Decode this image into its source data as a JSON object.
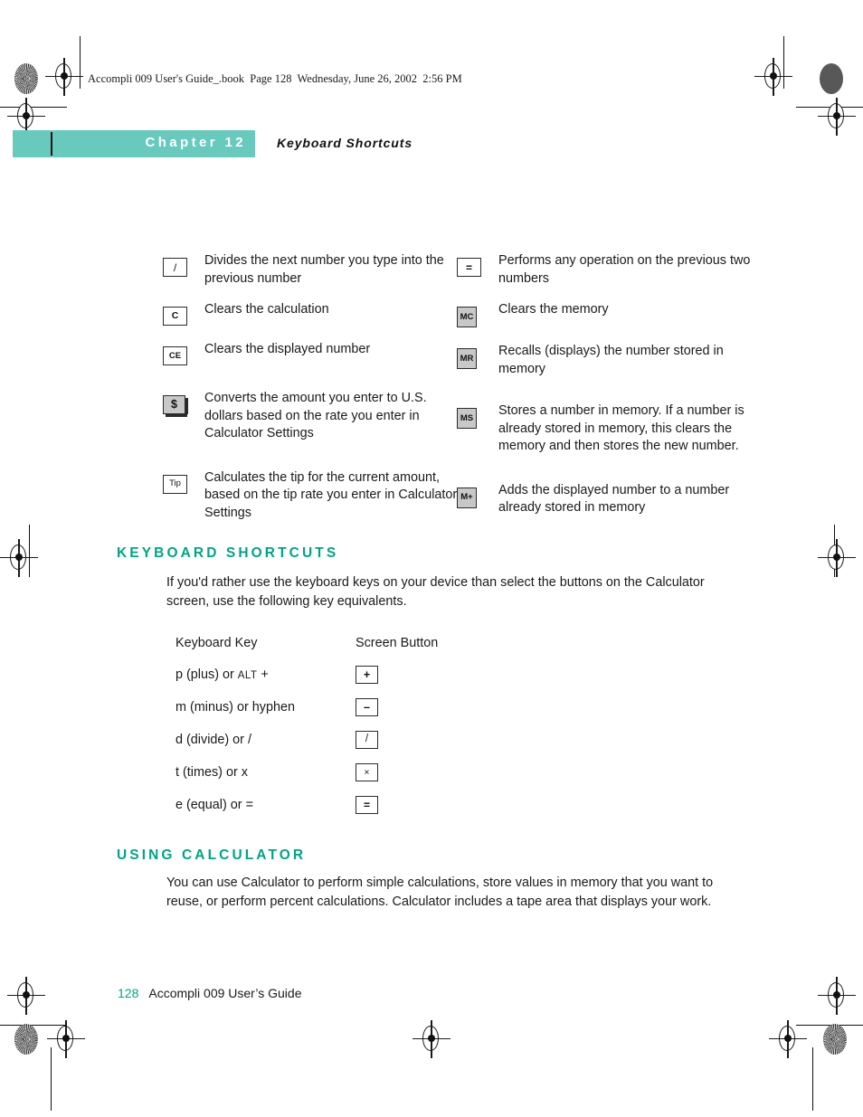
{
  "book_header": "Accompli 009 User's Guide_.book  Page 128  Wednesday, June 26, 2002  2:56 PM",
  "chapter": {
    "label": "Chapter 12",
    "title": "Keyboard Shortcuts"
  },
  "button_definitions": {
    "left_column": [
      {
        "icon": "divide-button-icon",
        "glyph": "/",
        "style": "white",
        "size": "wide",
        "description": "Divides the next number you type into the previous number"
      },
      {
        "icon": "clear-button-icon",
        "glyph": "C",
        "style": "white",
        "size": "wide",
        "description": "Clears the calculation"
      },
      {
        "icon": "clear-entry-button-icon",
        "glyph": "CE",
        "style": "white",
        "size": "wide",
        "description": "Clears the displayed number"
      },
      {
        "icon": "dollar-button-icon",
        "glyph": "$",
        "style": "gray",
        "size": "wide",
        "description": "Converts the amount you enter to U.S. dollars based on the rate you enter in Calculator Settings"
      },
      {
        "icon": "tip-button-icon",
        "glyph": "Tip",
        "style": "white",
        "size": "wide",
        "description": "Calculates the tip for the current amount, based on the tip rate you enter in Calculator Settings"
      }
    ],
    "right_column": [
      {
        "icon": "equals-button-icon",
        "glyph": "=",
        "style": "white",
        "size": "wide",
        "description": "Performs any operation on the previous two numbers"
      },
      {
        "icon": "memory-clear-button-icon",
        "glyph": "MC",
        "style": "gray",
        "size": "tall",
        "description": "Clears the memory"
      },
      {
        "icon": "memory-recall-button-icon",
        "glyph": "MR",
        "style": "gray",
        "size": "tall",
        "description": "Recalls (displays) the number stored in memory"
      },
      {
        "icon": "memory-store-button-icon",
        "glyph": "MS",
        "style": "gray",
        "size": "tall",
        "description": "Stores a number in memory. If a number is already stored in memory, this clears the memory and then stores the new number."
      },
      {
        "icon": "memory-add-button-icon",
        "glyph": "M+",
        "style": "gray",
        "size": "tall",
        "description": "Adds the displayed number to a number already stored in memory"
      }
    ]
  },
  "keyboard_shortcuts": {
    "heading": "KEYBOARD SHORTCUTS",
    "intro": "If you'd rather use the keyboard keys on your device than select the buttons on the Calculator screen, use the following key equivalents.",
    "columns": [
      "Keyboard Key",
      "Screen Button"
    ],
    "rows": [
      {
        "key_prefix": "p (plus) or ",
        "key_smallcap": "ALT",
        "key_suffix": " +",
        "button_glyph": "+",
        "icon": "plus-button-icon"
      },
      {
        "key_prefix": "m (minus) or hyphen",
        "key_smallcap": "",
        "key_suffix": "",
        "button_glyph": "–",
        "icon": "minus-button-icon"
      },
      {
        "key_prefix": "d (divide) or /",
        "key_smallcap": "",
        "key_suffix": "",
        "button_glyph": "/",
        "icon": "divide-button-icon"
      },
      {
        "key_prefix": "t (times) or x",
        "key_smallcap": "",
        "key_suffix": "",
        "button_glyph": "×",
        "icon": "times-button-icon"
      },
      {
        "key_prefix": "e (equal) or =",
        "key_smallcap": "",
        "key_suffix": "",
        "button_glyph": "=",
        "icon": "equals-button-icon"
      }
    ]
  },
  "using_calculator": {
    "heading": "USING CALCULATOR",
    "body": "You can use Calculator to perform simple calculations, store values in memory that you want to reuse, or perform percent calculations. Calculator includes a tape area that displays your work."
  },
  "footer": {
    "page_number": "128",
    "guide_name": "Accompli 009 User’s Guide"
  },
  "colors": {
    "chapter_bar": "#67cabd",
    "heading_green": "#00a486",
    "text": "#1a1a1a"
  }
}
